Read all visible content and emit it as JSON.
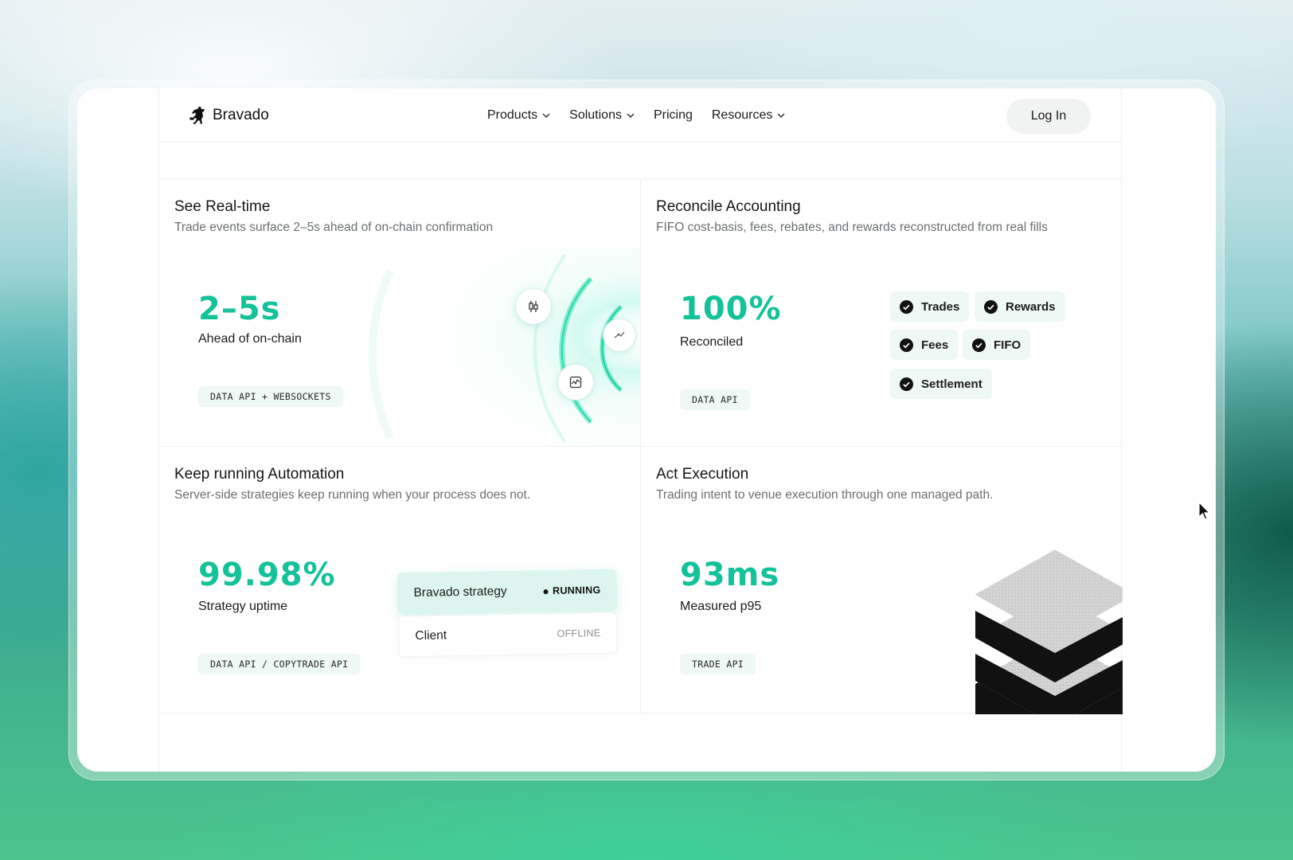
{
  "brand": {
    "name": "Bravado",
    "logo_icon": "horse-icon"
  },
  "nav": {
    "links": [
      {
        "label": "Products",
        "has_dropdown": true
      },
      {
        "label": "Solutions",
        "has_dropdown": true
      },
      {
        "label": "Pricing",
        "has_dropdown": false
      },
      {
        "label": "Resources",
        "has_dropdown": true
      }
    ],
    "login_label": "Log In"
  },
  "cards": {
    "realtime": {
      "title": "See Real-time",
      "subtitle": "Trade events surface 2–5s ahead of on-chain confirmation",
      "metric": "2–5s",
      "metric_label": "Ahead of on-chain",
      "tag": "DATA API + WEBSOCKETS",
      "icons": [
        "candlestick-chart-icon",
        "trend-line-icon",
        "activity-chart-icon"
      ]
    },
    "accounting": {
      "title": "Reconcile Accounting",
      "subtitle": "FIFO cost-basis, fees, rebates, and rewards reconstructed from real fills",
      "metric": "100%",
      "metric_label": "Reconciled",
      "tag": "DATA API",
      "chips": [
        "Trades",
        "Rewards",
        "Fees",
        "FIFO",
        "Settlement"
      ]
    },
    "automation": {
      "title": "Keep running Automation",
      "subtitle": "Server-side strategies keep running when your process does not.",
      "metric": "99.98%",
      "metric_label": "Strategy uptime",
      "tag": "DATA API / COPYTRADE API",
      "rows": [
        {
          "name": "Bravado strategy",
          "status": "RUNNING"
        },
        {
          "name": "Client",
          "status": "OFFLINE"
        }
      ]
    },
    "execution": {
      "title": "Act Execution",
      "subtitle": "Trading intent to venue execution through one managed path.",
      "metric": "93ms",
      "metric_label": "Measured p95",
      "tag": "TRADE API"
    }
  },
  "colors": {
    "accent": "#14c29a",
    "chip_bg": "#eef8f4",
    "text": "#111111",
    "muted": "#6b6f72"
  }
}
